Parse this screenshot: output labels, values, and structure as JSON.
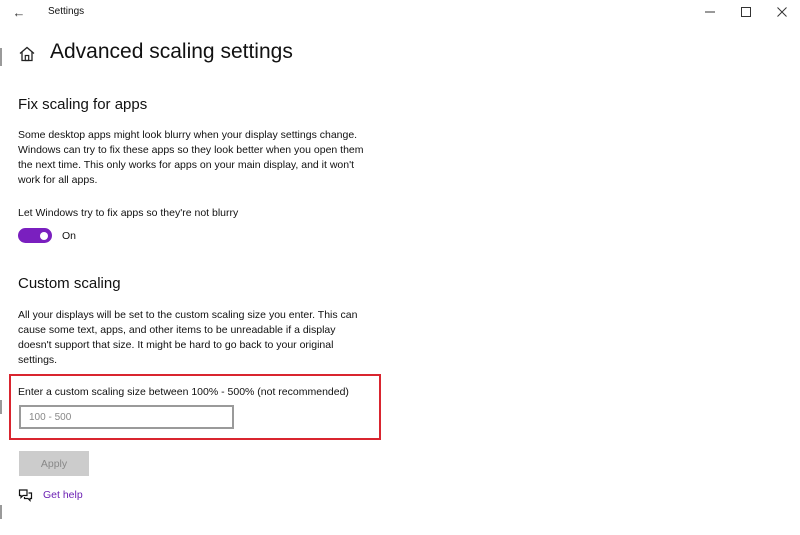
{
  "titlebar": {
    "app_title": "Settings",
    "back_glyph": "←",
    "minimize_glyph": "—",
    "maximize_glyph": "☐",
    "close_glyph": "✕"
  },
  "header": {
    "title": "Advanced scaling settings",
    "icon": "home-icon"
  },
  "fix_scaling": {
    "title": "Fix scaling for apps",
    "description": "Some desktop apps might look blurry when your display settings change. Windows can try to fix these apps so they look better when you open them the next time. This only works for apps on your main display, and it won't work for all apps.",
    "toggle_label": "Let Windows try to fix apps so they're not blurry",
    "toggle_state": "On",
    "toggle_on": true
  },
  "custom_scaling": {
    "title": "Custom scaling",
    "description": "All your displays will be set to the custom scaling size you enter. This can cause some text, apps, and other items to be unreadable if a display doesn't support that size. It might be hard to go back to your original settings.",
    "input_label": "Enter a custom scaling size between 100% - 500% (not recommended)",
    "input_value": "",
    "input_placeholder": "100 - 500",
    "apply_label": "Apply"
  },
  "help": {
    "label": "Get help",
    "icon": "chat-help-icon"
  },
  "colors": {
    "accent": "#7a1fbf",
    "link": "#6b1fb3",
    "highlight_border": "#d9252f",
    "disabled_button": "#cccccc"
  }
}
